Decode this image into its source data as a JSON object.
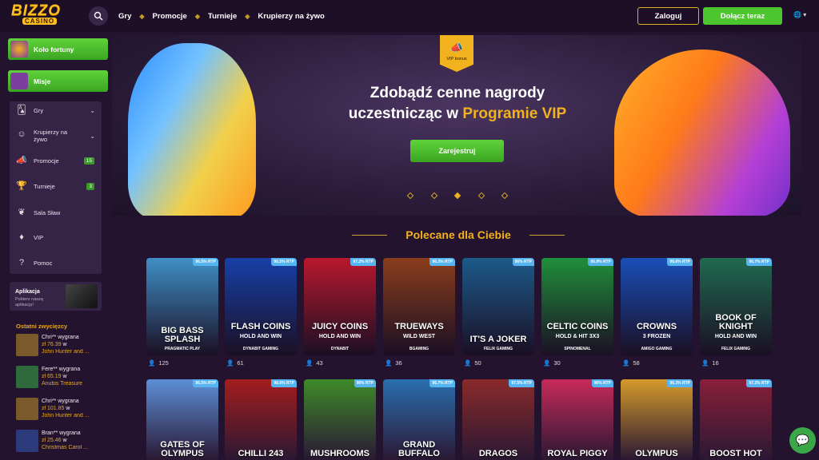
{
  "header": {
    "logo_top": "BIZZO",
    "logo_bottom": "CASINO",
    "nav": [
      "Gry",
      "Promocje",
      "Turnieje",
      "Krupierzy na żywo"
    ],
    "login": "Zaloguj",
    "join": "Dołącz teraz"
  },
  "sidebar": {
    "fortune": "Koło fortuny",
    "missions": "Misje",
    "menu": [
      {
        "label": "Gry",
        "icon": "cards-icon"
      },
      {
        "label": "Krupierzy na żywo",
        "icon": "dealer-icon"
      },
      {
        "label": "Promocje",
        "icon": "megaphone-icon",
        "badge": "15"
      },
      {
        "label": "Turnieje",
        "icon": "trophy-icon",
        "badge": "3"
      },
      {
        "label": "Sala Sław",
        "icon": "laurel-icon"
      },
      {
        "label": "VIP",
        "icon": "diamond-icon"
      },
      {
        "label": "Pomoc",
        "icon": "help-icon"
      }
    ],
    "app_title": "Aplikacja",
    "app_sub": "Pobierz naszą aplikację!",
    "winners_title": "Ostatni zwycięzcy",
    "winners": [
      {
        "line1": "Chri** wygrana",
        "amount": "zł 76.39",
        "game": "John Hunter and ...",
        "color": "#7a5a2a"
      },
      {
        "line1": "Fere** wygrana",
        "amount": "zł 65.19",
        "game": "Anubis Treasure",
        "color": "#2e6a3a"
      },
      {
        "line1": "Chri** wygrana",
        "amount": "zł 101.85",
        "game": "John Hunter and ...",
        "color": "#7a5a2a"
      },
      {
        "line1": "Bran** wygrana",
        "amount": "zł 25.46",
        "game": "Christmas Carol ...",
        "color": "#2a3a7a"
      }
    ]
  },
  "banner": {
    "badge": "VIP bonus",
    "line1": "Zdobądź cenne nagrody",
    "line2": "uczestnicząc w ",
    "line2_vip": "Programie VIP",
    "cta": "Zarejestruj"
  },
  "section_title": "Polecane dla Ciebie",
  "games_row1": [
    {
      "name": "BIG BASS SPLASH",
      "sub": "",
      "prov": "PRAGMATIC PLAY",
      "rtp": "96.5% RTP",
      "count": "125",
      "bg": "#3f8fc6"
    },
    {
      "name": "FLASH COINS",
      "sub": "HOLD AND WIN",
      "prov": "DYNABIT GAMING",
      "rtp": "96.5% RTP",
      "count": "61",
      "bg": "#1740a8"
    },
    {
      "name": "JUICY COINS",
      "sub": "HOLD AND WIN",
      "prov": "DYNABIT",
      "rtp": "97.2% RTP",
      "count": "43",
      "bg": "#b8182d"
    },
    {
      "name": "TRUEWAYS",
      "sub": "WILD WEST",
      "prov": "BGAMING",
      "rtp": "96.3% RTP",
      "count": "36",
      "bg": "#8a3d1c"
    },
    {
      "name": "IT'S A JOKER",
      "sub": "",
      "prov": "FELIX GAMING",
      "rtp": "96% RTP",
      "count": "50",
      "bg": "#1c5a8a"
    },
    {
      "name": "CELTIC COINS",
      "sub": "HOLD & HIT 3X3",
      "prov": "SPINOMENAL",
      "rtp": "96.9% RTP",
      "count": "30",
      "bg": "#1f8f3a"
    },
    {
      "name": "CROWNS",
      "sub": "3 FROZEN",
      "prov": "AMIGO GAMING",
      "rtp": "96.6% RTP",
      "count": "58",
      "bg": "#1a4fb8"
    },
    {
      "name": "BOOK OF KNIGHT",
      "sub": "HOLD AND WIN",
      "prov": "FELIX GAMING",
      "rtp": "96.7% RTP",
      "count": "16",
      "bg": "#1f6a4f"
    }
  ],
  "games_row2": [
    {
      "name": "GATES OF OLYMPUS",
      "rtp": "96.5% RTP",
      "bg": "#5c8fd6"
    },
    {
      "name": "CHILLI 243",
      "rtp": "96.6% RTP",
      "bg": "#a41d1d"
    },
    {
      "name": "MUSHROOMS",
      "rtp": "96% RTP",
      "bg": "#3e8a2a"
    },
    {
      "name": "GRAND BUFFALO",
      "rtp": "96.7% RTP",
      "bg": "#2a6fb0"
    },
    {
      "name": "DRAGOS",
      "rtp": "97.5% RTP",
      "bg": "#8a2a2a"
    },
    {
      "name": "ROYAL PIGGY",
      "rtp": "96% RTP",
      "bg": "#c72a5a"
    },
    {
      "name": "OLYMPUS",
      "rtp": "96.3% RTP",
      "bg": "#d49a2a"
    },
    {
      "name": "BOOST HOT",
      "rtp": "97.2% RTP",
      "bg": "#8a1f3a"
    }
  ]
}
